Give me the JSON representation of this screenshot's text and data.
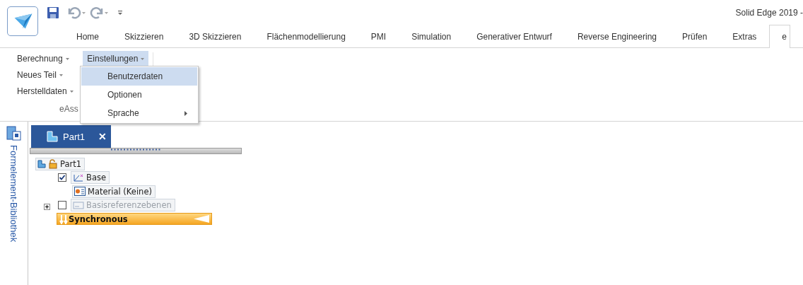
{
  "window": {
    "title": "Solid Edge 2019 -"
  },
  "ribbon_tabs": [
    {
      "label": "Home",
      "selected": false
    },
    {
      "label": "Skizzieren",
      "selected": false
    },
    {
      "label": "3D Skizzieren",
      "selected": false
    },
    {
      "label": "Flächenmodellierung",
      "selected": false
    },
    {
      "label": "PMI",
      "selected": false
    },
    {
      "label": "Simulation",
      "selected": false
    },
    {
      "label": "Generativer Entwurf",
      "selected": false
    },
    {
      "label": "Reverse Engineering",
      "selected": false
    },
    {
      "label": "Prüfen",
      "selected": false
    },
    {
      "label": "Extras",
      "selected": false
    },
    {
      "label": "e",
      "selected": true
    }
  ],
  "ribbon": {
    "buttons": [
      {
        "label": "Berechnung",
        "selected": false
      },
      {
        "label": "Einstellungen",
        "selected": true
      },
      {
        "label": "Neues Teil",
        "selected": false
      },
      {
        "label": "Herstelldaten",
        "selected": false
      }
    ],
    "group_label": "eAss"
  },
  "dropdown_menu": [
    {
      "label": "Benutzerdaten",
      "selected": true,
      "submenu": false
    },
    {
      "label": "Optionen",
      "selected": false,
      "submenu": false
    },
    {
      "label": "Sprache",
      "selected": false,
      "submenu": true
    }
  ],
  "sidebar": {
    "label": "Formelement-Bibliothek"
  },
  "document_tab": {
    "label": "Part1",
    "close": "✕"
  },
  "tree": {
    "label": "Part1",
    "children": [
      {
        "kind": "item",
        "label": "Base",
        "checked": true,
        "disabled": false
      },
      {
        "kind": "item",
        "label": "Material (Keine)",
        "disabled": false
      },
      {
        "kind": "item",
        "label": "Basisreferenzebenen",
        "checked": false,
        "expanded": false,
        "disabled": true
      },
      {
        "kind": "mode",
        "label": "Synchronous"
      }
    ]
  }
}
